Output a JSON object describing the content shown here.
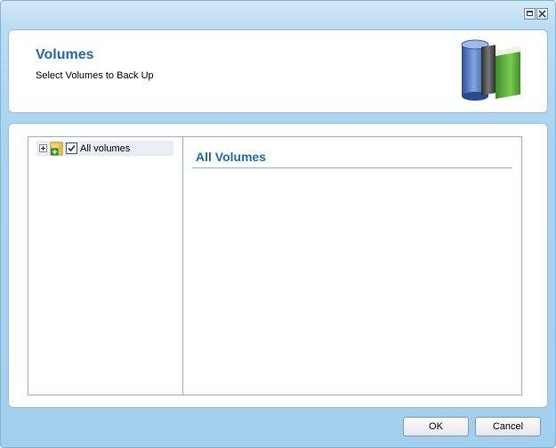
{
  "header": {
    "title": "Volumes",
    "subtitle": "Select Volumes to Back Up",
    "icon": "volumes-books-icon"
  },
  "tree": {
    "items": [
      {
        "label": "All volumes",
        "checked": true,
        "expanded": false,
        "icon": "volume-folder-icon"
      }
    ]
  },
  "detail": {
    "title": "All Volumes"
  },
  "buttons": {
    "ok": "OK",
    "cancel": "Cancel"
  },
  "colors": {
    "accent": "#1f6ca8",
    "window_bg": "#a9d3f0",
    "border": "#9fbfd8"
  }
}
